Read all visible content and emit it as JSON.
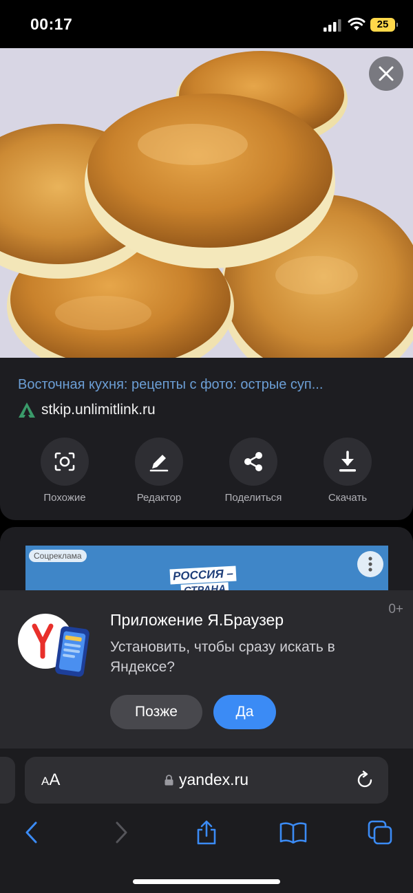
{
  "status_bar": {
    "time": "00:17",
    "battery": "25"
  },
  "image_result": {
    "title": "Восточная кухня: рецепты с фото: острые суп...",
    "source": "stkip.unlimitlink.ru",
    "actions": [
      {
        "label": "Похожие",
        "icon": "camera-lens-icon"
      },
      {
        "label": "Редактор",
        "icon": "pencil-icon"
      },
      {
        "label": "Поделиться",
        "icon": "share-icon"
      },
      {
        "label": "Скачать",
        "icon": "download-icon"
      }
    ]
  },
  "ad": {
    "badge": "Соцреклама",
    "logo_line1": "РОССИЯ –",
    "logo_line2": "СТРАНА"
  },
  "install_sheet": {
    "age_rating": "0+",
    "title": "Приложение Я.Браузер",
    "text": "Установить, чтобы сразу искать в Яндексе?",
    "later_label": "Позже",
    "yes_label": "Да"
  },
  "browser": {
    "text_size_label_small": "A",
    "text_size_label_big": "A",
    "url": "yandex.ru"
  },
  "colors": {
    "accent_blue": "#3b8bf5",
    "link_blue": "#6c9fd6",
    "battery_yellow": "#ffd84a"
  }
}
